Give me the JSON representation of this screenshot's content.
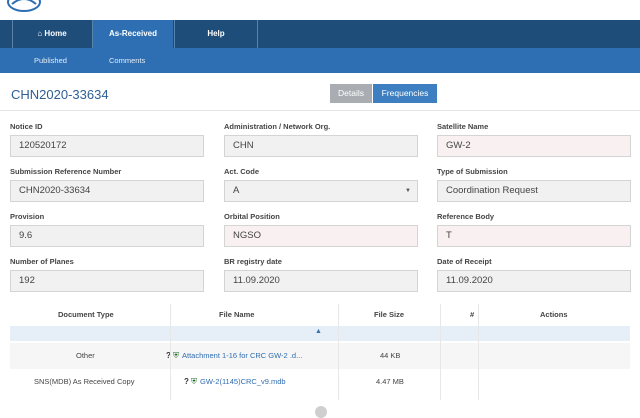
{
  "nav": {
    "home": "Home",
    "as_received": "As-Received",
    "help": "Help"
  },
  "subnav": {
    "published": "Published",
    "comments": "Comments"
  },
  "page": {
    "title": "CHN2020-33634",
    "details_btn": "Details",
    "frequencies_btn": "Frequencies"
  },
  "fields": [
    {
      "label": "Notice ID",
      "value": "120520172"
    },
    {
      "label": "Administration / Network Org.",
      "value": "CHN"
    },
    {
      "label": "Satellite Name",
      "value": "GW-2"
    },
    {
      "label": "Submission Reference Number",
      "value": "CHN2020-33634"
    },
    {
      "label": "Act. Code",
      "value": "A"
    },
    {
      "label": "Type of Submission",
      "value": "Coordination Request"
    },
    {
      "label": "Provision",
      "value": "9.6"
    },
    {
      "label": "Orbital Position",
      "value": "NGSO"
    },
    {
      "label": "Reference Body",
      "value": "T"
    },
    {
      "label": "Number of Planes",
      "value": "192"
    },
    {
      "label": "BR registry date",
      "value": "11.09.2020"
    },
    {
      "label": "Date of Receipt",
      "value": "11.09.2020"
    }
  ],
  "table": {
    "headers": [
      "Document Type",
      "File Name",
      "File Size",
      "#",
      "Actions"
    ],
    "rows": [
      {
        "type": "Other",
        "file": "Attachment 1-16 for CRC GW-2 .d...",
        "size": "44 KB"
      },
      {
        "type": "SNS(MDB) As Received Copy",
        "file": "GW-2(1145)CRC_v9.mdb",
        "size": "4.47 MB"
      }
    ]
  },
  "icons": {
    "help_mark": "?",
    "shield": "shield-icon"
  },
  "colors": {
    "nav": "#1f4d7a",
    "nav_active": "#2e6fb3",
    "accent": "#3d7fc1",
    "title": "#2e5f94"
  }
}
